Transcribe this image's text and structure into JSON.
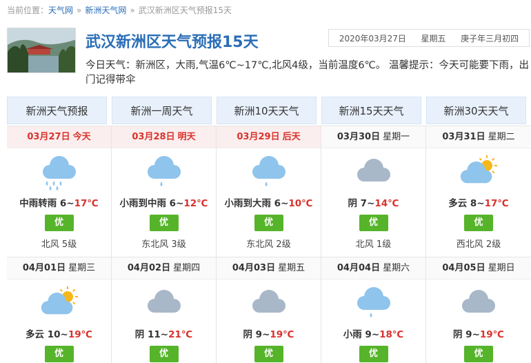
{
  "breadcrumb": {
    "prefix": "当前位置：",
    "items": [
      "天气网",
      "新洲天气网"
    ],
    "separator": "»",
    "current": "武汉新洲区天气预报15天"
  },
  "header": {
    "title": "武汉新洲区天气预报15天",
    "date": "2020年03月27日",
    "weekday": "星期五",
    "lunar": "庚子年三月初四",
    "summary": "今日天气：新洲区，大雨,气温6℃~17℃,北风4级，当前温度6℃。 温馨提示：今天可能要下雨，出门记得带伞"
  },
  "tabs": [
    "新洲天气预报",
    "新洲一周天气",
    "新洲10天天气",
    "新洲15天天气",
    "新洲30天天气"
  ],
  "days": [
    {
      "date": "03月27日",
      "week": "今天",
      "highlight": true,
      "icon": "heavy-rain",
      "cond": "中雨转雨",
      "lo": "6",
      "hi": "17℃",
      "aqi": "优",
      "wind": "北风 5级"
    },
    {
      "date": "03月28日",
      "week": "明天",
      "highlight": true,
      "icon": "light-rain",
      "cond": "小雨到中雨",
      "lo": "6",
      "hi": "12℃",
      "aqi": "优",
      "wind": "东北风 3级"
    },
    {
      "date": "03月29日",
      "week": "后天",
      "highlight": true,
      "icon": "light-rain",
      "cond": "小雨到大雨",
      "lo": "6",
      "hi": "10℃",
      "aqi": "优",
      "wind": "东北风 2级"
    },
    {
      "date": "03月30日",
      "week": "星期一",
      "highlight": false,
      "icon": "overcast",
      "cond": "阴",
      "lo": "7",
      "hi": "14℃",
      "aqi": "优",
      "wind": "北风 1级"
    },
    {
      "date": "03月31日",
      "week": "星期二",
      "highlight": false,
      "icon": "partly-cloudy",
      "cond": "多云",
      "lo": "8",
      "hi": "17℃",
      "aqi": "优",
      "wind": "西北风 2级"
    },
    {
      "date": "04月01日",
      "week": "星期三",
      "highlight": false,
      "icon": "partly-cloudy",
      "cond": "多云",
      "lo": "10",
      "hi": "19℃",
      "aqi": "优",
      "wind": ""
    },
    {
      "date": "04月02日",
      "week": "星期四",
      "highlight": false,
      "icon": "overcast",
      "cond": "阴",
      "lo": "11",
      "hi": "21℃",
      "aqi": "优",
      "wind": ""
    },
    {
      "date": "04月03日",
      "week": "星期五",
      "highlight": false,
      "icon": "overcast",
      "cond": "阴",
      "lo": "9",
      "hi": "19℃",
      "aqi": "优",
      "wind": ""
    },
    {
      "date": "04月04日",
      "week": "星期六",
      "highlight": false,
      "icon": "light-rain",
      "cond": "小雨",
      "lo": "9",
      "hi": "18℃",
      "aqi": "优",
      "wind": ""
    },
    {
      "date": "04月05日",
      "week": "星期日",
      "highlight": false,
      "icon": "overcast",
      "cond": "阴",
      "lo": "9",
      "hi": "19℃",
      "aqi": "优",
      "wind": ""
    }
  ],
  "colors": {
    "link": "#2a6db7",
    "hot": "#d9322c",
    "aqi_good": "#56b42a",
    "cloud_rain": "#8fc4ec",
    "cloud_grey": "#a9b8c9",
    "sun": "#f6b719"
  }
}
